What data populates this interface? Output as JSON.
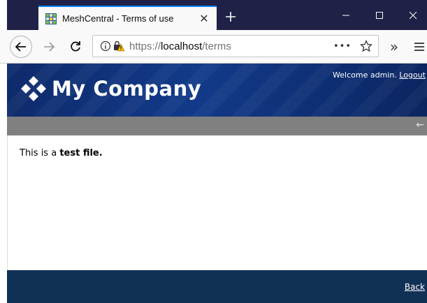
{
  "browser": {
    "tab_title": "MeshCentral - Terms of use",
    "tab_close": "✕",
    "new_tab": "+",
    "url_prefix": "https://",
    "url_host": "localhost",
    "url_path": "/terms",
    "more_actions": "•••",
    "overflow": "»",
    "accent_color": "#0a84ff",
    "titlebar_color": "#1f2147"
  },
  "header": {
    "logo_text": "My Company",
    "welcome_text": "Welcome admin.",
    "logout_label": "Logout",
    "color": "#123a8a"
  },
  "toolbar": {
    "back_arrow": "←"
  },
  "main": {
    "text_prefix": "This is a ",
    "text_bold": "test file."
  },
  "footer": {
    "back_label": "Back",
    "color": "#113055"
  }
}
